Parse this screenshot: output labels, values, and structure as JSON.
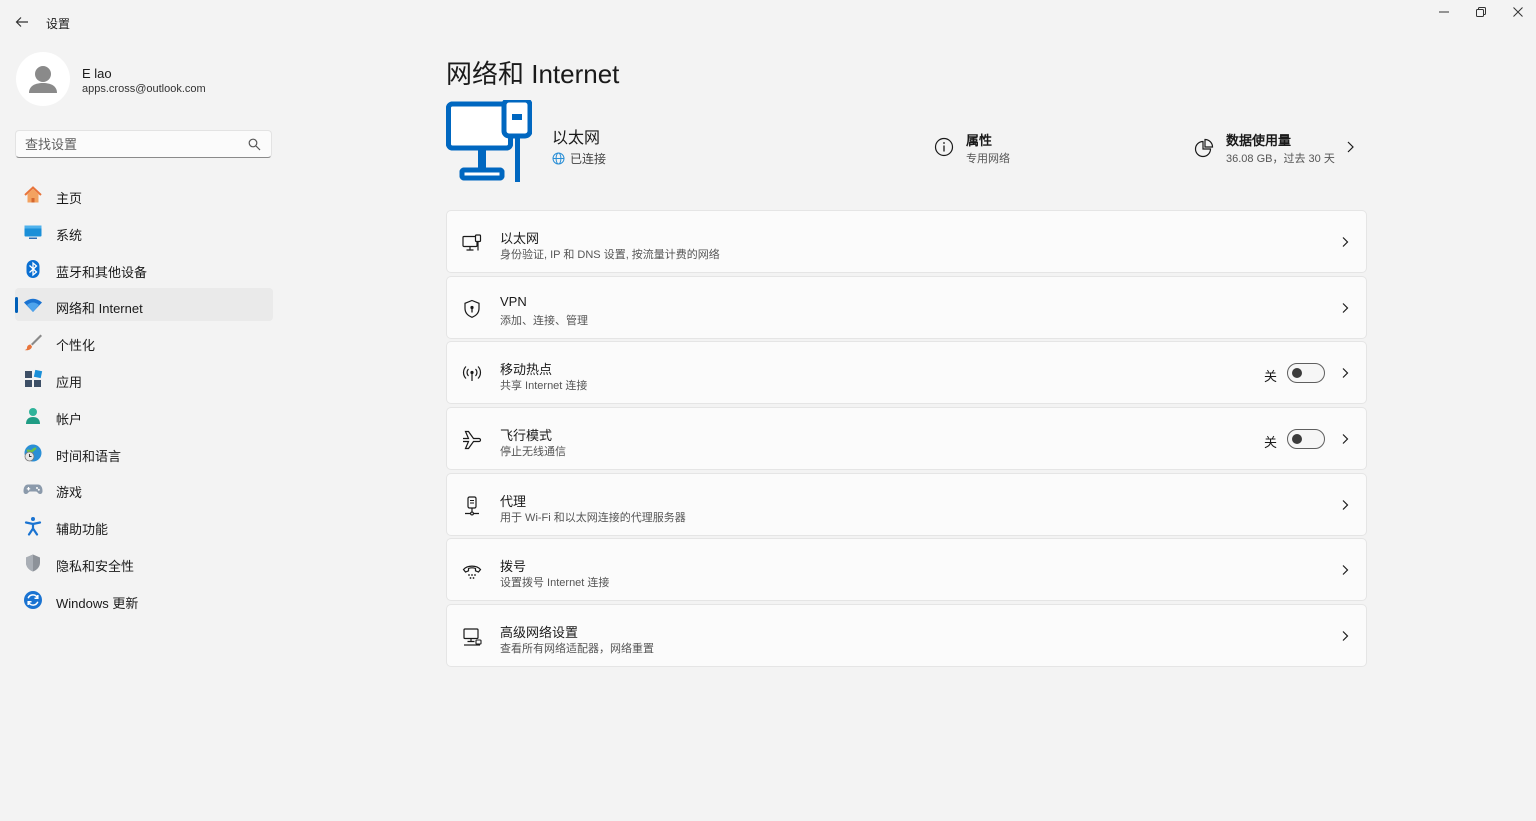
{
  "window": {
    "title": "设置",
    "back_icon": "back-arrow-icon",
    "controls": [
      "minimize-icon",
      "restore-icon",
      "close-icon"
    ]
  },
  "profile": {
    "name": "E lao",
    "email": "apps.cross@outlook.com"
  },
  "search": {
    "placeholder": "查找设置",
    "icon": "search-icon"
  },
  "nav": {
    "items": [
      {
        "label": "主页",
        "icon": "home-icon"
      },
      {
        "label": "系统",
        "icon": "system-icon"
      },
      {
        "label": "蓝牙和其他设备",
        "icon": "bluetooth-icon"
      },
      {
        "label": "网络和 Internet",
        "icon": "wifi-icon",
        "active": true
      },
      {
        "label": "个性化",
        "icon": "brush-icon"
      },
      {
        "label": "应用",
        "icon": "apps-icon"
      },
      {
        "label": "帐户",
        "icon": "account-icon"
      },
      {
        "label": "时间和语言",
        "icon": "globe-clock-icon"
      },
      {
        "label": "游戏",
        "icon": "gamepad-icon"
      },
      {
        "label": "辅助功能",
        "icon": "accessibility-icon"
      },
      {
        "label": "隐私和安全性",
        "icon": "shield-icon"
      },
      {
        "label": "Windows 更新",
        "icon": "update-icon"
      }
    ]
  },
  "main": {
    "title": "网络和 Internet",
    "hero": {
      "icon": "ethernet-computer-icon",
      "name": "以太网",
      "status": "已连接",
      "status_icon": "globe-icon",
      "properties": {
        "title": "属性",
        "subtitle": "专用网络",
        "icon": "info-icon"
      },
      "usage": {
        "title": "数据使用量",
        "subtitle": "36.08 GB，过去 30 天",
        "icon": "pie-chart-icon"
      }
    },
    "cards": [
      {
        "title": "以太网",
        "subtitle": "身份验证, IP 和 DNS 设置, 按流量计费的网络",
        "icon": "ethernet-icon"
      },
      {
        "title": "VPN",
        "subtitle": "添加、连接、管理",
        "icon": "vpn-shield-icon"
      },
      {
        "title": "移动热点",
        "subtitle": "共享 Internet 连接",
        "icon": "hotspot-icon",
        "toggle": {
          "state": "关",
          "on": false
        }
      },
      {
        "title": "飞行模式",
        "subtitle": "停止无线通信",
        "icon": "airplane-icon",
        "toggle": {
          "state": "关",
          "on": false
        }
      },
      {
        "title": "代理",
        "subtitle": "用于 Wi-Fi 和以太网连接的代理服务器",
        "icon": "proxy-icon"
      },
      {
        "title": "拨号",
        "subtitle": "设置拨号 Internet 连接",
        "icon": "dialup-icon"
      },
      {
        "title": "高级网络设置",
        "subtitle": "查看所有网络适配器，网络重置",
        "icon": "advanced-network-icon"
      }
    ]
  },
  "colors": {
    "accent": "#005fb8",
    "background": "#f3f3f3",
    "card": "#fbfbfb",
    "hero_icon": "#0067c0"
  }
}
